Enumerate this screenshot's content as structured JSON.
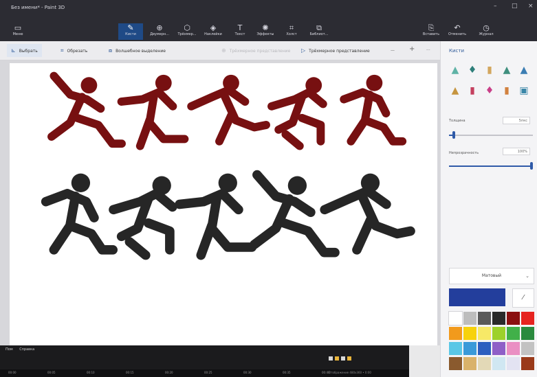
{
  "window": {
    "title": "Без имени* - Paint 3D",
    "controls": [
      "–",
      "□",
      "×"
    ]
  },
  "toolbar": {
    "menu": {
      "icon": "folder-icon",
      "label": "Меню"
    },
    "tools": [
      {
        "name": "brushes",
        "icon": "brush-icon",
        "glyph": "✎",
        "label": "Кисти",
        "active": true
      },
      {
        "name": "shapes2d",
        "icon": "shapes-2d-icon",
        "glyph": "⊕",
        "label": "Двумерн...",
        "active": false
      },
      {
        "name": "shapes3d",
        "icon": "shapes-3d-icon",
        "glyph": "⬡",
        "label": "Трёхмер...",
        "active": false
      },
      {
        "name": "stickers",
        "icon": "sticker-icon",
        "glyph": "◈",
        "label": "Наклейки",
        "active": false
      },
      {
        "name": "text",
        "icon": "text-icon",
        "glyph": "T",
        "label": "Текст",
        "active": false
      },
      {
        "name": "effects",
        "icon": "effects-icon",
        "glyph": "✺",
        "label": "Эффекты",
        "active": false
      },
      {
        "name": "canvas",
        "icon": "canvas-icon",
        "glyph": "⌗",
        "label": "Холст",
        "active": false
      },
      {
        "name": "library",
        "icon": "library-icon",
        "glyph": "⧉",
        "label": "Библиот...",
        "active": false
      }
    ],
    "right_tools": [
      {
        "name": "paste",
        "icon": "paste-icon",
        "glyph": "⎘",
        "label": "Вставить"
      },
      {
        "name": "undo",
        "icon": "undo-icon",
        "glyph": "↶",
        "label": "Отменить"
      },
      {
        "name": "history",
        "icon": "history-icon",
        "glyph": "◷",
        "label": "Журнал"
      }
    ]
  },
  "subbar": {
    "select": "Выбрать",
    "crop": "Обрезать",
    "magic_select": "Волшебное выделение",
    "faded_item": "Трёхмерное представление",
    "view_3d": "Трёхмерное представление",
    "zoom_minus": "—",
    "zoom_plus": "+",
    "more": "···"
  },
  "panel": {
    "title": "Кисти",
    "brushes": [
      {
        "icon": "marker-icon",
        "glyph": "▲",
        "color": "#5fb3a6"
      },
      {
        "icon": "calligraphy-pen-icon",
        "glyph": "♦",
        "color": "#2e7f7a"
      },
      {
        "icon": "oil-brush-icon",
        "glyph": "▮",
        "color": "#d3a65e"
      },
      {
        "icon": "watercolor-icon",
        "glyph": "▲",
        "color": "#3f8f7e"
      },
      {
        "icon": "pixel-pen-icon",
        "glyph": "▲",
        "color": "#3b7db3"
      },
      {
        "icon": "pencil-icon",
        "glyph": "▲",
        "color": "#c6953f"
      },
      {
        "icon": "eraser-icon",
        "glyph": "▮",
        "color": "#c4405f"
      },
      {
        "icon": "crayon-icon",
        "glyph": "♦",
        "color": "#c93f88"
      },
      {
        "icon": "spray-can-icon",
        "glyph": "▮",
        "color": "#d2813f"
      },
      {
        "icon": "fill-icon",
        "glyph": "▣",
        "color": "#3a86a8"
      }
    ],
    "thickness_label": "Толщина",
    "thickness_value": "5пкс",
    "thickness_level": 0.06,
    "opacity_label": "Непрозрачность",
    "opacity_value": "100%",
    "opacity_level": 1.0,
    "material": "Матовый",
    "current_color": "#233e9c",
    "palette": [
      "#ffffff",
      "#bdbdbd",
      "#5a5a5a",
      "#2a2a2a",
      "#8a1010",
      "#e62420",
      "#f29a1c",
      "#f7d20c",
      "#f7e967",
      "#9dd12b",
      "#41b049",
      "#2a8a3e",
      "#5ac7e6",
      "#3a9ad9",
      "#2d5fbf",
      "#8f5fc7",
      "#ea8fc3",
      "#c2c2c2",
      "#8a5a2e",
      "#d9b26a",
      "#e3d9b7",
      "#d0e7f2",
      "#e3e3f2",
      "#9a3a1a"
    ]
  },
  "taskbar": {
    "menu": [
      "Пом",
      "Справка"
    ],
    "timeline": [
      "00:00",
      "00:05",
      "00:10",
      "00:15",
      "00:20",
      "00:25",
      "00:30",
      "00:35",
      "00:40"
    ],
    "status": "Отображение 480x360 • 0:00"
  },
  "colors": {
    "runner_top": "#771011",
    "runner_bottom": "#262626",
    "accent": "#2f5aa8"
  }
}
